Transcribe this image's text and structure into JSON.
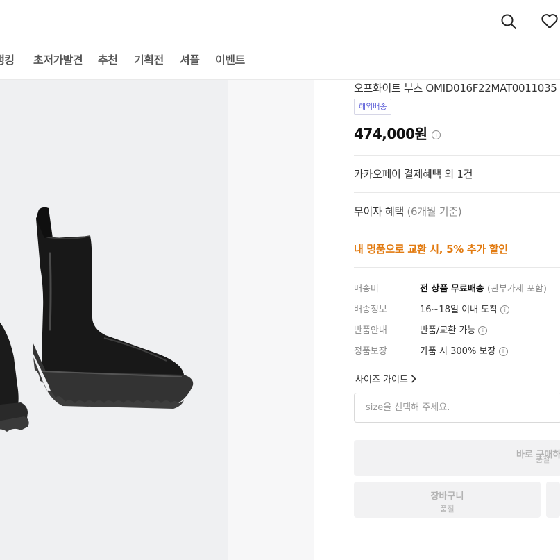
{
  "header": {
    "nav": [
      {
        "label": "랭킹"
      },
      {
        "label": "초저가발견"
      },
      {
        "label": "추천"
      },
      {
        "label": "기획전"
      },
      {
        "label": "셔플"
      },
      {
        "label": "이벤트"
      }
    ],
    "icons": [
      "search-icon",
      "heart-icon"
    ]
  },
  "product": {
    "name": "오프화이트 부츠 OMID016F22MAT0011035",
    "badge": "해외배송",
    "price": "474,000원",
    "info_glyph": "i"
  },
  "benefits": {
    "kakaopay": "카카오페이 결제혜택 외 1건",
    "installment": "무이자 혜택",
    "installment_sub": "(6개월 기준)",
    "exchange": "내 명품으로 교환 시, 5% 추가 할인"
  },
  "specs": [
    {
      "label": "배송비",
      "value": "전 상품 무료배송",
      "sub": "(관부가세 포함)"
    },
    {
      "label": "배송정보",
      "value": "16~18일 이내 도착"
    },
    {
      "label": "반품안내",
      "value": "반품/교환 가능"
    },
    {
      "label": "정품보장",
      "value": "가품 시 300% 보장"
    }
  ],
  "size": {
    "guide_label": "사이즈 가이드",
    "placeholder": "size을 선택해 주세요."
  },
  "buttons": {
    "buy_now": "바로 구매하",
    "cart": "장바구니",
    "sold_out": "품절"
  },
  "colors": {
    "accent_orange": "#e27b11",
    "badge_purple": "#5d5fd8",
    "disabled_bg": "#f2f2f3"
  }
}
